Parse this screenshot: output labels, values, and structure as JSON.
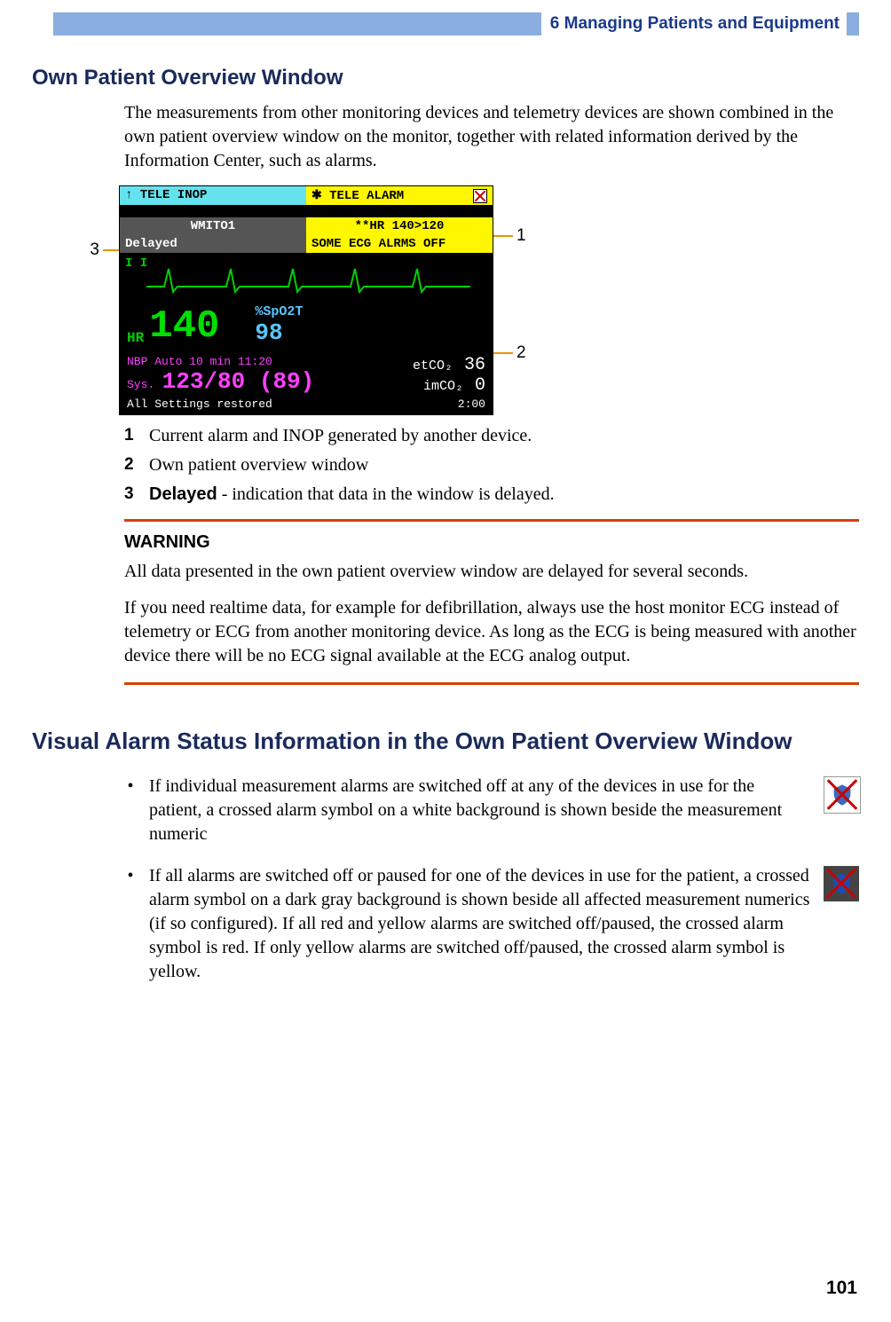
{
  "header": {
    "chapter": "6  Managing Patients and Equipment"
  },
  "section1_title": "Own Patient Overview Window",
  "intro_para": "The measurements from other monitoring devices and telemetry devices are shown combined in the own patient overview window on the monitor, together with related information derived by the Information Center, such as alarms.",
  "monitor": {
    "inop_label": "↑ TELE INOP",
    "alarm_label": "✱ TELE ALARM",
    "device_id": "WMITO1",
    "hr_banner": "**HR   140>120",
    "delayed": "Delayed",
    "alarms_off": "SOME ECG ALRMS OFF",
    "lead": "I I",
    "hr_label": "HR",
    "hr_value": "140",
    "spo2_label": "%SpO2T",
    "spo2_value": "98",
    "nbp_head": "NBP  Auto 10 min 11:20",
    "nbp_sys": "Sys.",
    "nbp_value": "123/80 (89)",
    "etco2_label": "etCO₂",
    "etco2_value": "36",
    "imco2_label": "imCO₂",
    "imco2_value": "0",
    "footer_left": "All Settings restored",
    "footer_right": "2:00"
  },
  "callouts": {
    "c1": "1",
    "c2": "2",
    "c3": "3"
  },
  "legend": {
    "n1": "1",
    "t1": "Current alarm and INOP generated by another device.",
    "n2": "2",
    "t2": "Own patient overview window",
    "n3": "3",
    "t3_bold": "Delayed",
    "t3_rest": " - indication that data in the window is delayed."
  },
  "warning": {
    "head": "WARNING",
    "p1": "All data presented in the own patient overview window are delayed for several seconds.",
    "p2": "If you need realtime data, for example for defibrillation, always use the host monitor ECG instead of telemetry or ECG from another monitoring device. As long as the ECG is being measured with another device there will be no ECG signal available at the ECG analog output."
  },
  "section2_title": "Visual Alarm Status Information in the Own Patient Overview Window",
  "bullets": {
    "b1": "If individual measurement alarms are switched off at any of the devices in use for the patient, a crossed alarm symbol on a white background is shown beside the measurement numeric",
    "b2": "If all alarms are switched off or paused for one of the devices in use for the patient, a crossed alarm symbol on a dark gray background is shown beside all affected measurement numerics (if so configured). If all red and yellow alarms are switched off/paused, the crossed alarm symbol is red. If only yellow alarms are switched off/paused, the crossed alarm symbol is yellow."
  },
  "page_number": "101"
}
